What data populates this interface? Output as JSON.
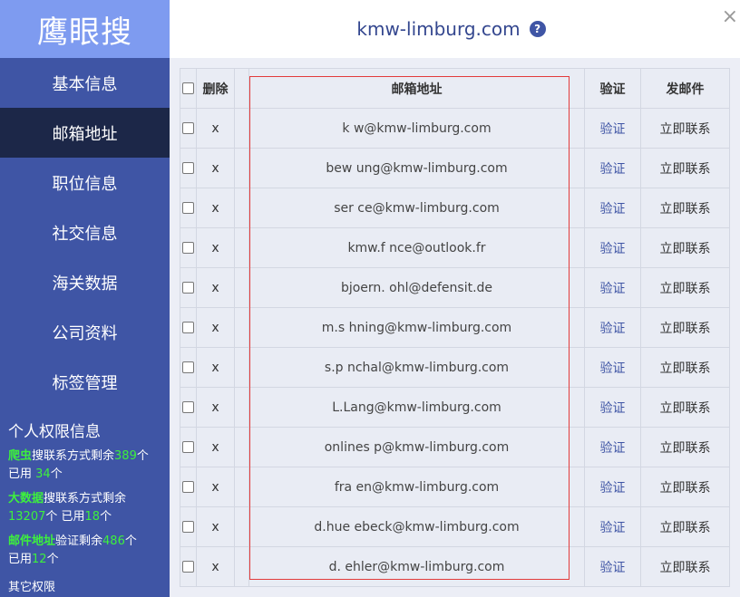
{
  "sidebar": {
    "logo": "鹰眼搜",
    "nav": [
      "基本信息",
      "邮箱地址",
      "职位信息",
      "社交信息",
      "海关数据",
      "公司资料",
      "标签管理"
    ],
    "permissions": {
      "title": "个人权限信息",
      "crawler": {
        "label": "爬虫",
        "text1": "搜联系方式剩余",
        "remaining": "389",
        "unit1": "个",
        "text2": "已用 ",
        "used": "34",
        "unit2": "个"
      },
      "bigdata": {
        "label": "大数据",
        "text1": "搜联系方式剩余",
        "remaining": "13207",
        "unit1": "个",
        "text2": " 已用",
        "used": "18",
        "unit2": "个"
      },
      "email": {
        "label": "邮件地址",
        "text1": "验证剩余",
        "remaining": "486",
        "unit1": "个",
        "text2": "已用",
        "used": "12",
        "unit2": "个"
      },
      "other": "其它权限"
    }
  },
  "header": {
    "domain": "kmw-limburg.com",
    "help": "?",
    "close": "×"
  },
  "table": {
    "headers": {
      "delete": "删除",
      "email": "邮箱地址",
      "verify": "验证",
      "send": "发邮件"
    },
    "rows": [
      {
        "del": "x",
        "email": "k  w@kmw-limburg.com",
        "verify": "验证",
        "send": "立即联系"
      },
      {
        "del": "x",
        "email": "bew   ung@kmw-limburg.com",
        "verify": "验证",
        "send": "立即联系"
      },
      {
        "del": "x",
        "email": "ser  ce@kmw-limburg.com",
        "verify": "验证",
        "send": "立即联系"
      },
      {
        "del": "x",
        "email": "kmw.f   nce@outlook.fr",
        "verify": "验证",
        "send": "立即联系"
      },
      {
        "del": "x",
        "email": "bjoern.   ohl@defensit.de",
        "verify": "验证",
        "send": "立即联系"
      },
      {
        "del": "x",
        "email": "m.s   hning@kmw-limburg.com",
        "verify": "验证",
        "send": "立即联系"
      },
      {
        "del": "x",
        "email": "s.p   nchal@kmw-limburg.com",
        "verify": "验证",
        "send": "立即联系"
      },
      {
        "del": "x",
        "email": "L.Lang@kmw-limburg.com",
        "verify": "验证",
        "send": "立即联系"
      },
      {
        "del": "x",
        "email": "onlines   p@kmw-limburg.com",
        "verify": "验证",
        "send": "立即联系"
      },
      {
        "del": "x",
        "email": "fra   en@kmw-limburg.com",
        "verify": "验证",
        "send": "立即联系"
      },
      {
        "del": "x",
        "email": "d.hue   ebeck@kmw-limburg.com",
        "verify": "验证",
        "send": "立即联系"
      },
      {
        "del": "x",
        "email": "d.   ehler@kmw-limburg.com",
        "verify": "验证",
        "send": "立即联系"
      }
    ]
  },
  "colors": {
    "sidebar": "#3f55a5",
    "logo_bg": "#7e9bf0",
    "active_nav": "#1c2748",
    "accent_green": "#3df03d",
    "highlight_border": "#e23b3b"
  }
}
